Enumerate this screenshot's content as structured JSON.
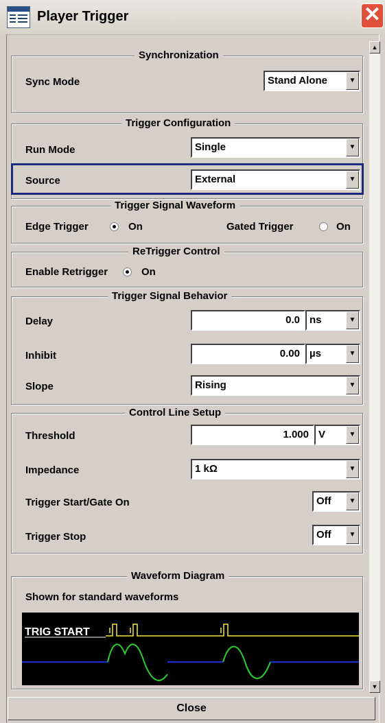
{
  "window": {
    "title": "Player Trigger",
    "close_icon": "close-icon",
    "app_icon": "trigger-app-icon"
  },
  "sync": {
    "title": "Synchronization",
    "mode_label": "Sync Mode",
    "mode_value": "Stand Alone"
  },
  "trigger_config": {
    "title": "Trigger Configuration",
    "run_mode_label": "Run Mode",
    "run_mode_value": "Single",
    "source_label": "Source",
    "source_value": "External"
  },
  "waveform": {
    "title": "Trigger Signal Waveform",
    "edge_label": "Edge Trigger",
    "edge_on": "On",
    "edge_selected": true,
    "gated_label": "Gated Trigger",
    "gated_on": "On",
    "gated_selected": false
  },
  "retrigger": {
    "title": "ReTrigger Control",
    "enable_label": "Enable Retrigger",
    "enable_on": "On",
    "enable_selected": true
  },
  "behavior": {
    "title": "Trigger Signal Behavior",
    "delay_label": "Delay",
    "delay_value": "0.0",
    "delay_unit": "ns",
    "inhibit_label": "Inhibit",
    "inhibit_value": "0.00",
    "inhibit_unit": "µs",
    "slope_label": "Slope",
    "slope_value": "Rising"
  },
  "control_line": {
    "title": "Control Line Setup",
    "threshold_label": "Threshold",
    "threshold_value": "1.000",
    "threshold_unit": "V",
    "impedance_label": "Impedance",
    "impedance_value": "1 kΩ",
    "start_label": "Trigger Start/Gate On",
    "start_value": "Off",
    "stop_label": "Trigger Stop",
    "stop_value": "Off"
  },
  "diagram": {
    "title": "Waveform Diagram",
    "subtitle": "Shown for standard waveforms",
    "trig_label": "TRIG START",
    "trig_color": "#f5e642",
    "rf_line_color": "#1a2fd0",
    "wave_color": "#2ecc2e"
  },
  "footer": {
    "close_label": "Close"
  },
  "colors": {
    "dialog_bg": "#d4d0c8",
    "focus": "#1b2a7a",
    "title_close": "#e0503a"
  }
}
